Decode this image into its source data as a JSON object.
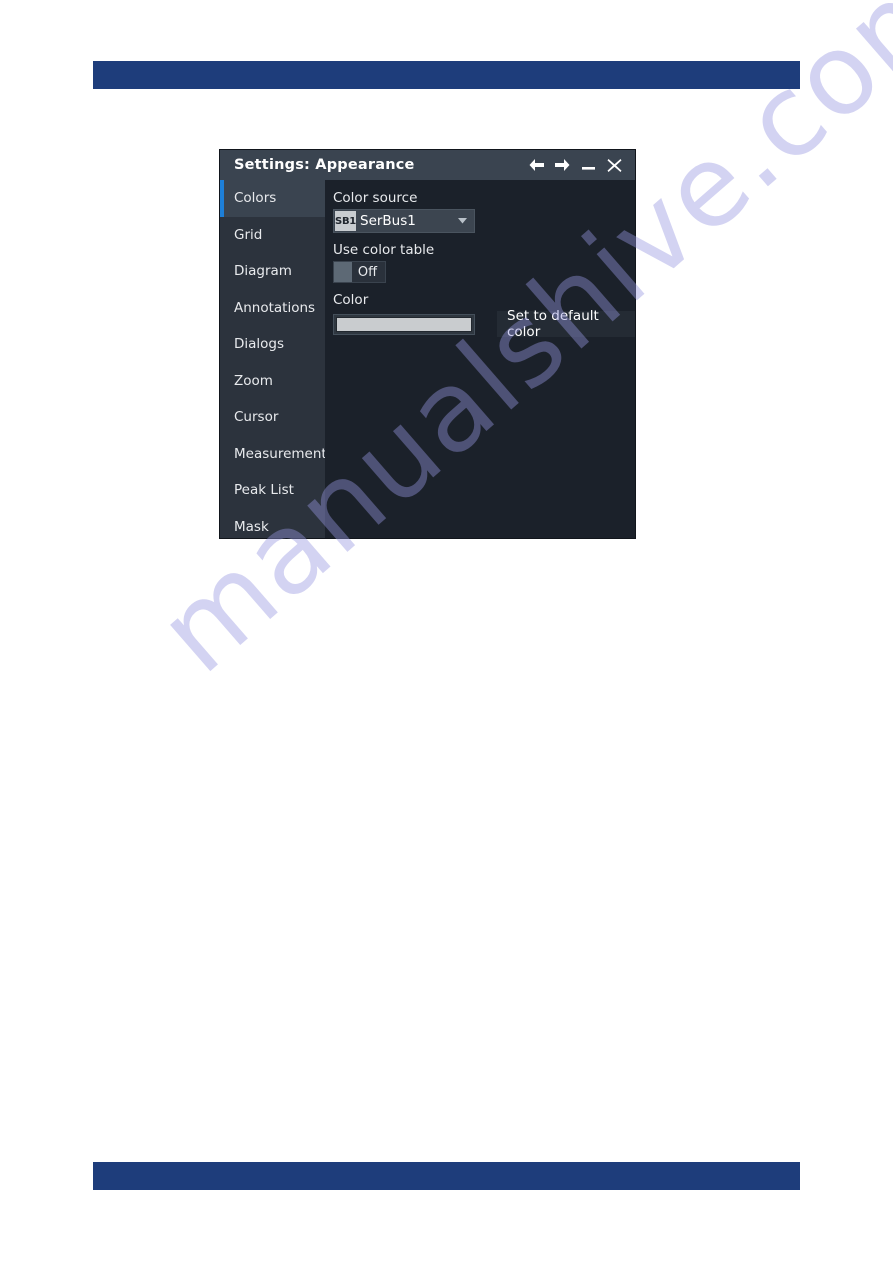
{
  "page": {
    "watermark_text": "manualshive.com",
    "header_bar_color": "#1e3d7b",
    "footer_bar_color": "#1e3d7b"
  },
  "dialog": {
    "title": "Settings: Appearance",
    "titlebar_buttons": [
      {
        "name": "back-button",
        "icon": "arrow-left-icon"
      },
      {
        "name": "forward-button",
        "icon": "arrow-right-icon"
      },
      {
        "name": "minimize-button",
        "icon": "minimize-icon"
      },
      {
        "name": "close-button",
        "icon": "close-icon"
      }
    ],
    "accent_color": "#1d7fd8",
    "sidebar": {
      "selected": "Colors",
      "items": [
        {
          "label": "Colors"
        },
        {
          "label": "Grid"
        },
        {
          "label": "Diagram"
        },
        {
          "label": "Annotations"
        },
        {
          "label": "Dialogs"
        },
        {
          "label": "Zoom"
        },
        {
          "label": "Cursor"
        },
        {
          "label": "Measurement"
        },
        {
          "label": "Peak List"
        },
        {
          "label": "Mask"
        }
      ]
    },
    "content": {
      "color_source": {
        "label": "Color source",
        "badge": "SB1",
        "value": "SerBus1"
      },
      "use_color_table": {
        "label": "Use color table",
        "state": "Off"
      },
      "color": {
        "label": "Color",
        "swatch_color": "#c9cccf",
        "set_default_button": "Set to default color"
      }
    }
  }
}
